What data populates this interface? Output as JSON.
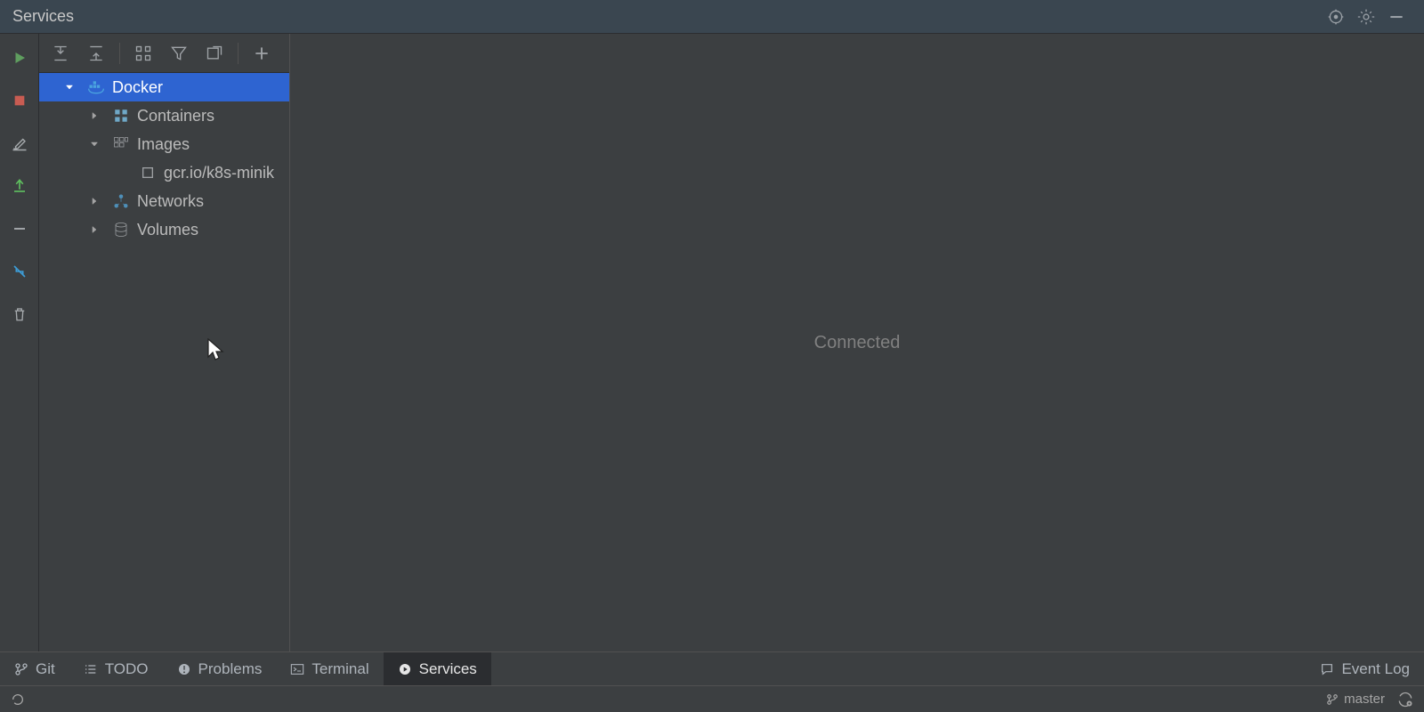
{
  "header": {
    "title": "Services"
  },
  "gutter_icons": [
    "run-icon",
    "stop-icon",
    "edit-icon",
    "deploy-icon",
    "remove-icon",
    "collapse-icon",
    "trash-icon"
  ],
  "tree_toolbar_icons": [
    "expand-all-icon",
    "collapse-all-icon",
    "group-by-icon",
    "filter-icon",
    "open-tab-icon",
    "add-icon"
  ],
  "tree": {
    "root": {
      "label": "Docker",
      "icon": "docker-icon",
      "expanded": true,
      "selected": true,
      "children": [
        {
          "label": "Containers",
          "icon": "containers-icon",
          "expanded": false
        },
        {
          "label": "Images",
          "icon": "images-icon",
          "expanded": true,
          "children": [
            {
              "label": "gcr.io/k8s-minik",
              "icon": "image-item-icon",
              "leaf": true
            }
          ]
        },
        {
          "label": "Networks",
          "icon": "networks-icon",
          "expanded": false
        },
        {
          "label": "Volumes",
          "icon": "volumes-icon",
          "expanded": false
        }
      ]
    }
  },
  "main": {
    "status_text": "Connected"
  },
  "tool_windows": [
    {
      "id": "git",
      "label": "Git",
      "icon": "vcs-branch-icon",
      "active": false
    },
    {
      "id": "todo",
      "label": "TODO",
      "icon": "list-icon",
      "active": false
    },
    {
      "id": "problems",
      "label": "Problems",
      "icon": "warning-icon",
      "active": false
    },
    {
      "id": "terminal",
      "label": "Terminal",
      "icon": "terminal-icon",
      "active": false
    },
    {
      "id": "services",
      "label": "Services",
      "icon": "play-circle-icon",
      "active": true
    }
  ],
  "tool_windows_right": [
    {
      "id": "eventlog",
      "label": "Event Log",
      "icon": "speech-icon"
    }
  ],
  "statusbar": {
    "branch_label": "master"
  }
}
